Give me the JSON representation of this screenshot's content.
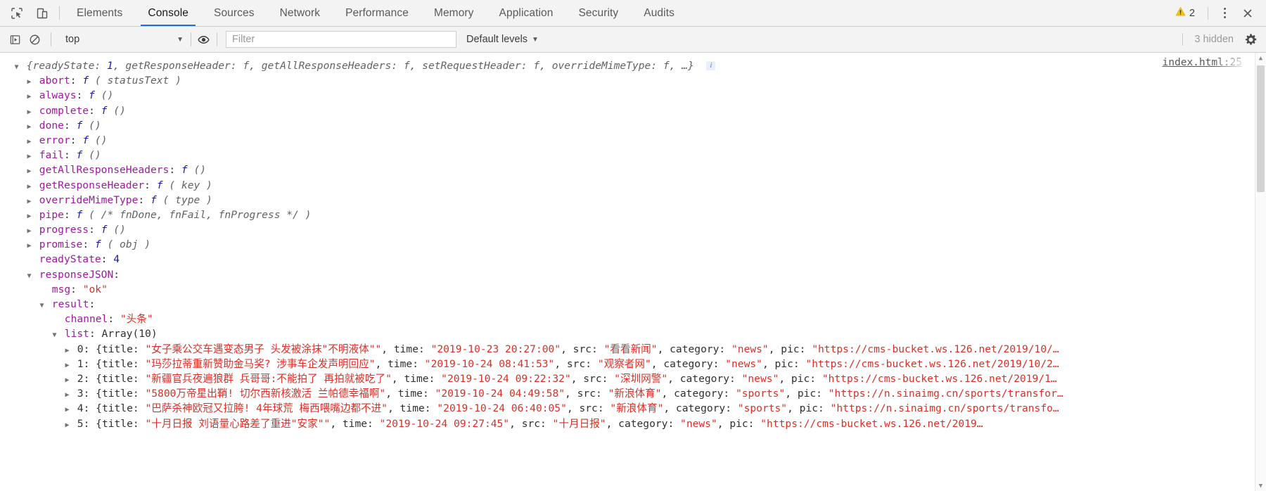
{
  "window": {
    "tabs": [
      {
        "label": "Elements",
        "active": false
      },
      {
        "label": "Console",
        "active": true
      },
      {
        "label": "Sources",
        "active": false
      },
      {
        "label": "Network",
        "active": false
      },
      {
        "label": "Performance",
        "active": false
      },
      {
        "label": "Memory",
        "active": false
      },
      {
        "label": "Application",
        "active": false
      },
      {
        "label": "Security",
        "active": false
      },
      {
        "label": "Audits",
        "active": false
      }
    ],
    "warning_count": "2",
    "icons": {
      "inspect": "inspect-element-icon",
      "device": "device-toolbar-icon",
      "warning": "warning-triangle-icon",
      "more": "more-options-icon",
      "close": "close-icon"
    },
    "accent": "#1976d2",
    "warning_color": "#f5c211"
  },
  "toolbar": {
    "execute_icon": "execute-context-icon",
    "clear_icon": "clear-console-icon",
    "eye_icon": "live-expression-eye-icon",
    "context": "top",
    "context_caret": "▼",
    "filter_placeholder": "Filter",
    "filter_value": "",
    "levels_label": "Default levels",
    "levels_caret": "▼",
    "hidden_label": "3 hidden",
    "settings_icon": "settings-gear-icon"
  },
  "console": {
    "source_link": "index.html:25",
    "scrollbar": {
      "up": "▲",
      "down": "▼"
    },
    "lines": [
      {
        "indent": 0,
        "arrow": "open",
        "segments": [
          {
            "t": "{",
            "c": "preview"
          },
          {
            "t": "readyState",
            "c": "preview"
          },
          {
            "t": ": ",
            "c": "preview"
          },
          {
            "t": "1",
            "c": "previewnum"
          },
          {
            "t": ", getResponseHeader: ",
            "c": "preview"
          },
          {
            "t": "f",
            "c": "preview"
          },
          {
            "t": ", getAllResponseHeaders: ",
            "c": "preview"
          },
          {
            "t": "f",
            "c": "preview"
          },
          {
            "t": ", setRequestHeader: ",
            "c": "preview"
          },
          {
            "t": "f",
            "c": "preview"
          },
          {
            "t": ", overrideMimeType: ",
            "c": "preview"
          },
          {
            "t": "f",
            "c": "preview"
          },
          {
            "t": ", …}",
            "c": "preview"
          },
          {
            "t": "  ",
            "c": "plain"
          },
          {
            "t": "INFO_BADGE",
            "c": "badge"
          }
        ]
      },
      {
        "indent": 1,
        "arrow": "closed",
        "segments": [
          {
            "t": "abort",
            "c": "prop"
          },
          {
            "t": ": ",
            "c": "plain"
          },
          {
            "t": "f",
            "c": "fnk"
          },
          {
            "t": " ( statusText )",
            "c": "it"
          }
        ]
      },
      {
        "indent": 1,
        "arrow": "closed",
        "segments": [
          {
            "t": "always",
            "c": "prop"
          },
          {
            "t": ": ",
            "c": "plain"
          },
          {
            "t": "f",
            "c": "fnk"
          },
          {
            "t": " ()",
            "c": "it"
          }
        ]
      },
      {
        "indent": 1,
        "arrow": "closed",
        "segments": [
          {
            "t": "complete",
            "c": "prop"
          },
          {
            "t": ": ",
            "c": "plain"
          },
          {
            "t": "f",
            "c": "fnk"
          },
          {
            "t": " ()",
            "c": "it"
          }
        ]
      },
      {
        "indent": 1,
        "arrow": "closed",
        "segments": [
          {
            "t": "done",
            "c": "prop"
          },
          {
            "t": ": ",
            "c": "plain"
          },
          {
            "t": "f",
            "c": "fnk"
          },
          {
            "t": " ()",
            "c": "it"
          }
        ]
      },
      {
        "indent": 1,
        "arrow": "closed",
        "segments": [
          {
            "t": "error",
            "c": "prop"
          },
          {
            "t": ": ",
            "c": "plain"
          },
          {
            "t": "f",
            "c": "fnk"
          },
          {
            "t": " ()",
            "c": "it"
          }
        ]
      },
      {
        "indent": 1,
        "arrow": "closed",
        "segments": [
          {
            "t": "fail",
            "c": "prop"
          },
          {
            "t": ": ",
            "c": "plain"
          },
          {
            "t": "f",
            "c": "fnk"
          },
          {
            "t": " ()",
            "c": "it"
          }
        ]
      },
      {
        "indent": 1,
        "arrow": "closed",
        "segments": [
          {
            "t": "getAllResponseHeaders",
            "c": "prop"
          },
          {
            "t": ": ",
            "c": "plain"
          },
          {
            "t": "f",
            "c": "fnk"
          },
          {
            "t": " ()",
            "c": "it"
          }
        ]
      },
      {
        "indent": 1,
        "arrow": "closed",
        "segments": [
          {
            "t": "getResponseHeader",
            "c": "prop"
          },
          {
            "t": ": ",
            "c": "plain"
          },
          {
            "t": "f",
            "c": "fnk"
          },
          {
            "t": " ( key )",
            "c": "it"
          }
        ]
      },
      {
        "indent": 1,
        "arrow": "closed",
        "segments": [
          {
            "t": "overrideMimeType",
            "c": "prop"
          },
          {
            "t": ": ",
            "c": "plain"
          },
          {
            "t": "f",
            "c": "fnk"
          },
          {
            "t": " ( type )",
            "c": "it"
          }
        ]
      },
      {
        "indent": 1,
        "arrow": "closed",
        "segments": [
          {
            "t": "pipe",
            "c": "prop"
          },
          {
            "t": ": ",
            "c": "plain"
          },
          {
            "t": "f",
            "c": "fnk"
          },
          {
            "t": " ( /* fnDone, fnFail, fnProgress */ )",
            "c": "it"
          }
        ]
      },
      {
        "indent": 1,
        "arrow": "closed",
        "segments": [
          {
            "t": "progress",
            "c": "prop"
          },
          {
            "t": ": ",
            "c": "plain"
          },
          {
            "t": "f",
            "c": "fnk"
          },
          {
            "t": " ()",
            "c": "it"
          }
        ]
      },
      {
        "indent": 1,
        "arrow": "closed",
        "segments": [
          {
            "t": "promise",
            "c": "prop"
          },
          {
            "t": ": ",
            "c": "plain"
          },
          {
            "t": "f",
            "c": "fnk"
          },
          {
            "t": " ( obj )",
            "c": "it"
          }
        ]
      },
      {
        "indent": 1,
        "arrow": "blank",
        "segments": [
          {
            "t": "readyState",
            "c": "prop"
          },
          {
            "t": ": ",
            "c": "plain"
          },
          {
            "t": "4",
            "c": "num"
          }
        ]
      },
      {
        "indent": 1,
        "arrow": "open",
        "segments": [
          {
            "t": "responseJSON",
            "c": "prop"
          },
          {
            "t": ":",
            "c": "plain"
          }
        ]
      },
      {
        "indent": 2,
        "arrow": "blank",
        "segments": [
          {
            "t": "msg",
            "c": "prop"
          },
          {
            "t": ": ",
            "c": "plain"
          },
          {
            "t": "\"ok\"",
            "c": "str"
          }
        ]
      },
      {
        "indent": 2,
        "arrow": "open",
        "segments": [
          {
            "t": "result",
            "c": "prop"
          },
          {
            "t": ":",
            "c": "plain"
          }
        ]
      },
      {
        "indent": 3,
        "arrow": "blank",
        "segments": [
          {
            "t": "channel",
            "c": "prop"
          },
          {
            "t": ": ",
            "c": "plain"
          },
          {
            "t": "\"头条\"",
            "c": "str"
          }
        ]
      },
      {
        "indent": 3,
        "arrow": "open",
        "segments": [
          {
            "t": "list",
            "c": "prop"
          },
          {
            "t": ": ",
            "c": "plain"
          },
          {
            "t": "Array(10)",
            "c": "plain"
          }
        ]
      },
      {
        "indent": 4,
        "arrow": "closed",
        "segments": [
          {
            "t": "0",
            "c": "plain"
          },
          {
            "t": ": {title: ",
            "c": "plain"
          },
          {
            "t": "\"女子乘公交车遇变态男子 头发被涂抹\"不明液体\"\"",
            "c": "str"
          },
          {
            "t": ", time: ",
            "c": "plain"
          },
          {
            "t": "\"2019-10-23 20:27:00\"",
            "c": "str"
          },
          {
            "t": ", src: ",
            "c": "plain"
          },
          {
            "t": "\"看看新闻\"",
            "c": "str"
          },
          {
            "t": ", category: ",
            "c": "plain"
          },
          {
            "t": "\"news\"",
            "c": "str"
          },
          {
            "t": ", pic: ",
            "c": "plain"
          },
          {
            "t": "\"https://cms-bucket.ws.126.net/2019/10/…",
            "c": "str"
          }
        ]
      },
      {
        "indent": 4,
        "arrow": "closed",
        "segments": [
          {
            "t": "1",
            "c": "plain"
          },
          {
            "t": ": {title: ",
            "c": "plain"
          },
          {
            "t": "\"玛莎拉蒂重新赞助金马奖? 涉事车企发声明回应\"",
            "c": "str"
          },
          {
            "t": ", time: ",
            "c": "plain"
          },
          {
            "t": "\"2019-10-24 08:41:53\"",
            "c": "str"
          },
          {
            "t": ", src: ",
            "c": "plain"
          },
          {
            "t": "\"观察者网\"",
            "c": "str"
          },
          {
            "t": ", category: ",
            "c": "plain"
          },
          {
            "t": "\"news\"",
            "c": "str"
          },
          {
            "t": ", pic: ",
            "c": "plain"
          },
          {
            "t": "\"https://cms-bucket.ws.126.net/2019/10/2…",
            "c": "str"
          }
        ]
      },
      {
        "indent": 4,
        "arrow": "closed",
        "segments": [
          {
            "t": "2",
            "c": "plain"
          },
          {
            "t": ": {title: ",
            "c": "plain"
          },
          {
            "t": "\"新疆官兵夜遍狼群 兵哥哥:不能拍了 再拍就被吃了\"",
            "c": "str"
          },
          {
            "t": ", time: ",
            "c": "plain"
          },
          {
            "t": "\"2019-10-24 09:22:32\"",
            "c": "str"
          },
          {
            "t": ", src: ",
            "c": "plain"
          },
          {
            "t": "\"深圳网警\"",
            "c": "str"
          },
          {
            "t": ", category: ",
            "c": "plain"
          },
          {
            "t": "\"news\"",
            "c": "str"
          },
          {
            "t": ", pic: ",
            "c": "plain"
          },
          {
            "t": "\"https://cms-bucket.ws.126.net/2019/1…",
            "c": "str"
          }
        ]
      },
      {
        "indent": 4,
        "arrow": "closed",
        "segments": [
          {
            "t": "3",
            "c": "plain"
          },
          {
            "t": ": {title: ",
            "c": "plain"
          },
          {
            "t": "\"5800万帝星出鞘! 切尔西新核激活 兰帕德幸福啊\"",
            "c": "str"
          },
          {
            "t": ", time: ",
            "c": "plain"
          },
          {
            "t": "\"2019-10-24 04:49:58\"",
            "c": "str"
          },
          {
            "t": ", src: ",
            "c": "plain"
          },
          {
            "t": "\"新浪体育\"",
            "c": "str"
          },
          {
            "t": ", category: ",
            "c": "plain"
          },
          {
            "t": "\"sports\"",
            "c": "str"
          },
          {
            "t": ", pic: ",
            "c": "plain"
          },
          {
            "t": "\"https://n.sinaimg.cn/sports/transfor…",
            "c": "str"
          }
        ]
      },
      {
        "indent": 4,
        "arrow": "closed",
        "segments": [
          {
            "t": "4",
            "c": "plain"
          },
          {
            "t": ": {title: ",
            "c": "plain"
          },
          {
            "t": "\"巴萨杀神欧冠又拉胯! 4年球荒 梅西喂嘴边都不进\"",
            "c": "str"
          },
          {
            "t": ", time: ",
            "c": "plain"
          },
          {
            "t": "\"2019-10-24 06:40:05\"",
            "c": "str"
          },
          {
            "t": ", src: ",
            "c": "plain"
          },
          {
            "t": "\"新浪体育\"",
            "c": "str"
          },
          {
            "t": ", category: ",
            "c": "plain"
          },
          {
            "t": "\"sports\"",
            "c": "str"
          },
          {
            "t": ", pic: ",
            "c": "plain"
          },
          {
            "t": "\"https://n.sinaimg.cn/sports/transfo…",
            "c": "str"
          }
        ]
      },
      {
        "indent": 4,
        "arrow": "closed",
        "segments": [
          {
            "t": "5",
            "c": "plain"
          },
          {
            "t": ": {title: ",
            "c": "plain"
          },
          {
            "t": "\"十月日报 刘语量心路差了重进\"安家\"\"",
            "c": "str"
          },
          {
            "t": ", time: ",
            "c": "plain"
          },
          {
            "t": "\"2019-10-24 09:27:45\"",
            "c": "str"
          },
          {
            "t": ", src: ",
            "c": "plain"
          },
          {
            "t": "\"十月日报\"",
            "c": "str"
          },
          {
            "t": ", category: ",
            "c": "plain"
          },
          {
            "t": "\"news\"",
            "c": "str"
          },
          {
            "t": ", pic: ",
            "c": "plain"
          },
          {
            "t": "\"https://cms-bucket.ws.126.net/2019…",
            "c": "str"
          }
        ]
      }
    ]
  }
}
